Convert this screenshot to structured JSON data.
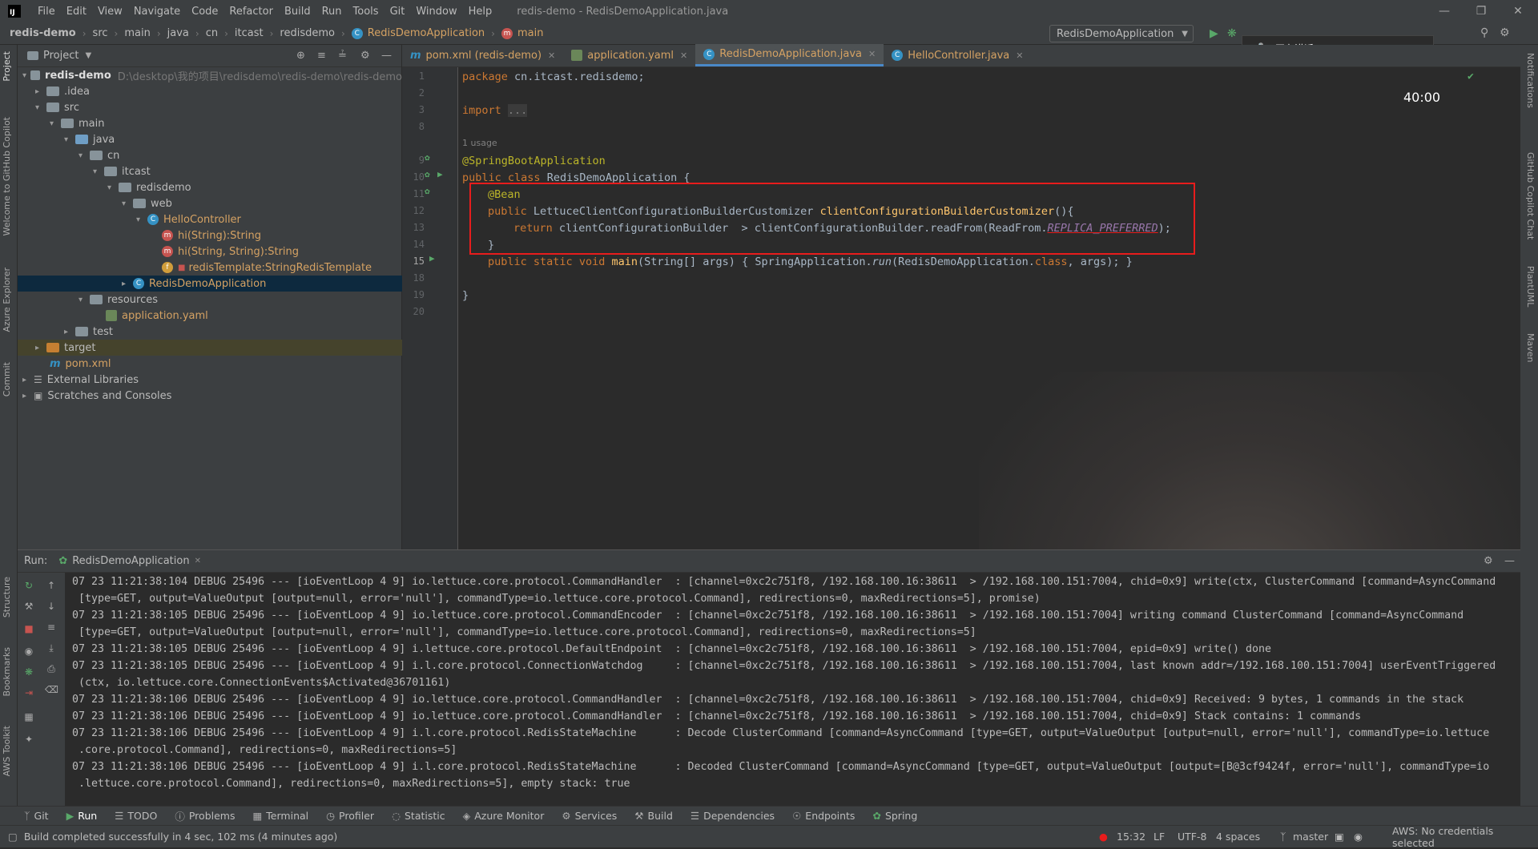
{
  "app": {
    "window_title": "redis-demo - RedisDemoApplication.java",
    "logo": "IJ"
  },
  "menu": [
    "File",
    "Edit",
    "View",
    "Navigate",
    "Code",
    "Refactor",
    "Build",
    "Run",
    "Tools",
    "Git",
    "Window",
    "Help"
  ],
  "breadcrumbs": [
    "redis-demo",
    "src",
    "main",
    "java",
    "cn",
    "itcast",
    "redisdemo",
    "RedisDemoApplication",
    "main"
  ],
  "run_config": "RedisDemoApplication",
  "overlay": {
    "speaking_label": "正在讲话:",
    "timer": "40:00"
  },
  "project": {
    "header": "Project",
    "tree": [
      {
        "label": "redis-demo",
        "path": "D:\\desktop\\我的项目\\redisdemo\\redis-demo\\redis-demo"
      },
      {
        "label": ".idea"
      },
      {
        "label": "src"
      },
      {
        "label": "main"
      },
      {
        "label": "java"
      },
      {
        "label": "cn"
      },
      {
        "label": "itcast"
      },
      {
        "label": "redisdemo"
      },
      {
        "label": "web"
      },
      {
        "label": "HelloController"
      },
      {
        "label": "hi(String):String"
      },
      {
        "label": "hi(String, String):String"
      },
      {
        "label": "redisTemplate:StringRedisTemplate"
      },
      {
        "label": "RedisDemoApplication"
      },
      {
        "label": "resources"
      },
      {
        "label": "application.yaml"
      },
      {
        "label": "test"
      },
      {
        "label": "target"
      },
      {
        "label": "pom.xml"
      },
      {
        "label": "External Libraries"
      },
      {
        "label": "Scratches and Consoles"
      }
    ]
  },
  "tabs": [
    "pom.xml (redis-demo)",
    "application.yaml",
    "RedisDemoApplication.java",
    "HelloController.java"
  ],
  "editor": {
    "line_numbers": [
      "1",
      "2",
      "3",
      "8",
      "9",
      "10",
      "11",
      "12",
      "13",
      "14",
      "15",
      "18",
      "19",
      "20"
    ],
    "usages": "1 usage",
    "lines": {
      "l1": [
        "package",
        "cn.itcast.redisdemo;"
      ],
      "l3": [
        "import",
        "..."
      ],
      "l9": "@SpringBootApplication",
      "l10": [
        "public",
        "class",
        "RedisDemoApplication {"
      ],
      "l11": "@Bean",
      "l12": [
        "public",
        "LettuceClientConfigurationBuilderCustomizer",
        "clientConfigurationBuilderCustomizer",
        "(){"
      ],
      "l13": [
        "return",
        "clientConfigurationBuilder  > clientConfigurationBuilder.readFrom(ReadFrom.",
        "REPLICA_PREFERRED",
        ");"
      ],
      "l14": "}",
      "l15": [
        "public",
        "static",
        "void",
        "main",
        "(String[] args) { SpringApplication.",
        "run",
        "(RedisDemoApplication.",
        "class",
        ", args); }"
      ],
      "l19": "}"
    }
  },
  "run": {
    "label": "Run:",
    "tab": "RedisDemoApplication",
    "logs": [
      "07 23 11:21:38:104 DEBUG 25496 --- [ioEventLoop 4 9] io.lettuce.core.protocol.CommandHandler  : [channel=0xc2c751f8, /192.168.100.16:38611  > /192.168.100.151:7004, chid=0x9] write(ctx, ClusterCommand [command=AsyncCommand",
      " [type=GET, output=ValueOutput [output=null, error='null'], commandType=io.lettuce.core.protocol.Command], redirections=0, maxRedirections=5], promise)",
      "07 23 11:21:38:105 DEBUG 25496 --- [ioEventLoop 4 9] io.lettuce.core.protocol.CommandEncoder  : [channel=0xc2c751f8, /192.168.100.16:38611  > /192.168.100.151:7004] writing command ClusterCommand [command=AsyncCommand",
      " [type=GET, output=ValueOutput [output=null, error='null'], commandType=io.lettuce.core.protocol.Command], redirections=0, maxRedirections=5]",
      "07 23 11:21:38:105 DEBUG 25496 --- [ioEventLoop 4 9] i.lettuce.core.protocol.DefaultEndpoint  : [channel=0xc2c751f8, /192.168.100.16:38611  > /192.168.100.151:7004, epid=0x9] write() done",
      "07 23 11:21:38:105 DEBUG 25496 --- [ioEventLoop 4 9] i.l.core.protocol.ConnectionWatchdog     : [channel=0xc2c751f8, /192.168.100.16:38611  > /192.168.100.151:7004, last known addr=/192.168.100.151:7004] userEventTriggered",
      " (ctx, io.lettuce.core.ConnectionEvents$Activated@36701161)",
      "07 23 11:21:38:106 DEBUG 25496 --- [ioEventLoop 4 9] io.lettuce.core.protocol.CommandHandler  : [channel=0xc2c751f8, /192.168.100.16:38611  > /192.168.100.151:7004, chid=0x9] Received: 9 bytes, 1 commands in the stack",
      "07 23 11:21:38:106 DEBUG 25496 --- [ioEventLoop 4 9] io.lettuce.core.protocol.CommandHandler  : [channel=0xc2c751f8, /192.168.100.16:38611  > /192.168.100.151:7004, chid=0x9] Stack contains: 1 commands",
      "07 23 11:21:38:106 DEBUG 25496 --- [ioEventLoop 4 9] i.l.core.protocol.RedisStateMachine      : Decode ClusterCommand [command=AsyncCommand [type=GET, output=ValueOutput [output=null, error='null'], commandType=io.lettuce",
      " .core.protocol.Command], redirections=0, maxRedirections=5]",
      "07 23 11:21:38:106 DEBUG 25496 --- [ioEventLoop 4 9] i.l.core.protocol.RedisStateMachine      : Decoded ClusterCommand [command=AsyncCommand [type=GET, output=ValueOutput [output=[B@3cf9424f, error='null'], commandType=io",
      " .lettuce.core.protocol.Command], redirections=0, maxRedirections=5], empty stack: true"
    ]
  },
  "left_tool_tabs": [
    "Project",
    "Welcome to GitHub Copilot",
    "Azure Explorer",
    "Commit",
    "Structure",
    "Bookmarks",
    "AWS Toolkit"
  ],
  "right_tool_tabs": [
    "Notifications",
    "GitHub Copilot Chat",
    "PlantUML",
    "Maven"
  ],
  "bottom_tabs": [
    "Git",
    "Run",
    "TODO",
    "Problems",
    "Terminal",
    "Profiler",
    "Statistic",
    "Azure Monitor",
    "Services",
    "Build",
    "Dependencies",
    "Endpoints",
    "Spring"
  ],
  "status": {
    "message": "Build completed successfully in 4 sec, 102 ms (4 minutes ago)",
    "position": "15:32",
    "line_sep": "LF",
    "encoding": "UTF-8",
    "indent": "4 spaces",
    "branch": "master",
    "aws": "AWS: No credentials selected"
  },
  "colors": {
    "accent": "#4a88c7",
    "highlight_box": "#e81c1c",
    "bg": "#2b2b2b",
    "panel": "#3c3f41"
  }
}
